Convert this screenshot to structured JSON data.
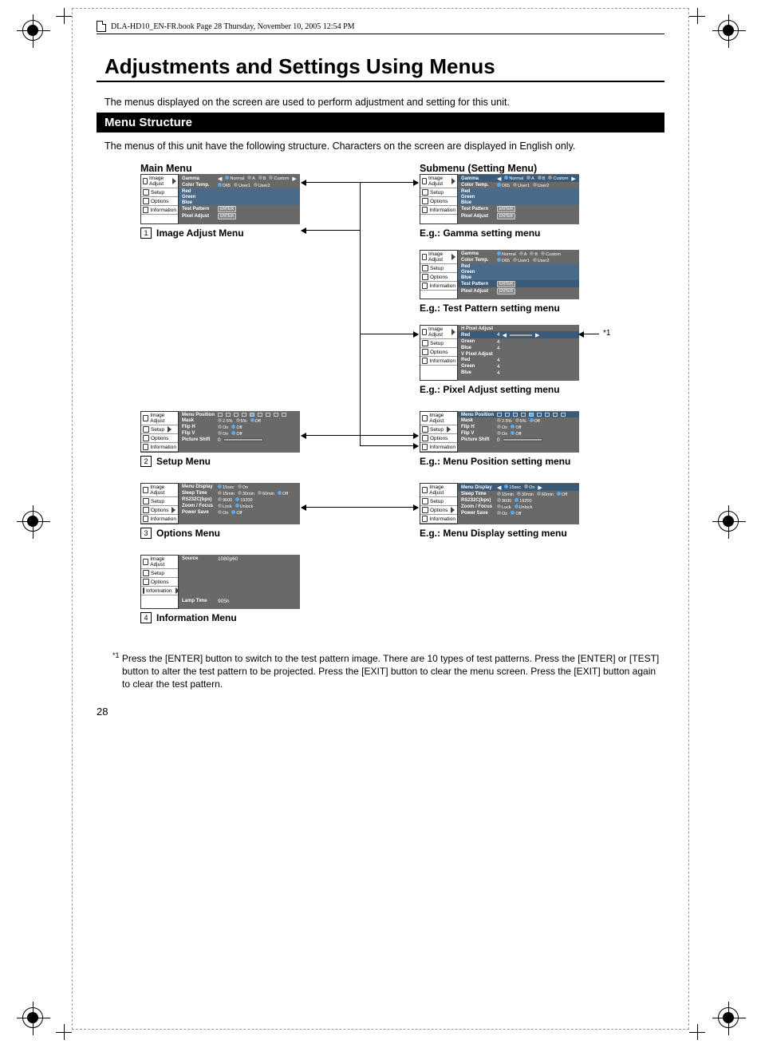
{
  "header_text": "DLA-HD10_EN-FR.book  Page 28  Thursday, November 10, 2005  12:54 PM",
  "title": "Adjustments and Settings Using Menus",
  "intro": "The menus displayed on the screen are used to perform adjustment and setting for this unit.",
  "section_heading": "Menu Structure",
  "intro2": "The menus of this unit have the following structure. Characters on the screen are displayed in English only.",
  "col_left": "Main Menu",
  "col_right": "Submenu (Setting Menu)",
  "sidebar": {
    "items": [
      "Image Adjust",
      "Setup",
      "Options",
      "Information"
    ]
  },
  "image_adjust": {
    "rows": [
      {
        "label": "Gamma",
        "opts": [
          "Normal",
          "A",
          "B",
          "Custom"
        ],
        "sel": 0,
        "arrows": true
      },
      {
        "label": "Color Temp.",
        "opts": [
          "D65",
          "User1",
          "User2"
        ],
        "sel": 0
      },
      {
        "label": "Red",
        "bar": true
      },
      {
        "label": "Green",
        "bar": true
      },
      {
        "label": "Blue",
        "bar": true
      },
      {
        "label": "Test Pattern",
        "enter": true
      },
      {
        "label": "Pixel Adjust",
        "enter": true
      }
    ]
  },
  "gamma_sub": {
    "rows": [
      {
        "label": "Gamma",
        "opts": [
          "Normal",
          "A",
          "B",
          "Custom"
        ],
        "sel": 0,
        "arrows": true,
        "hl": true
      },
      {
        "label": "Color Temp.",
        "opts": [
          "D65",
          "User1",
          "User2"
        ],
        "sel": 0
      },
      {
        "label": "Red",
        "bar": true
      },
      {
        "label": "Green",
        "bar": true
      },
      {
        "label": "Blue",
        "bar": true
      },
      {
        "label": "Test Pattern",
        "enter": true
      },
      {
        "label": "Pixel Adjust",
        "enter": true
      }
    ]
  },
  "test_pattern_sub": {
    "rows": [
      {
        "label": "Gamma",
        "opts": [
          "Normal",
          "A",
          "B",
          "Custom"
        ],
        "sel": 0
      },
      {
        "label": "Color Temp.",
        "opts": [
          "D65",
          "User1",
          "User2"
        ],
        "sel": 0
      },
      {
        "label": "Red",
        "bar": true
      },
      {
        "label": "Green",
        "bar": true
      },
      {
        "label": "Blue",
        "bar": true
      },
      {
        "label": "Test Pattern",
        "enter": true,
        "hl": true
      },
      {
        "label": "Pixel Adjust",
        "enter": true
      }
    ]
  },
  "pixel_adjust_sub": {
    "header1": "H Pixel Adjust",
    "rows1": [
      {
        "label": "Red",
        "val": "4",
        "hl": true,
        "arrows": true
      },
      {
        "label": "Green",
        "val": "4"
      },
      {
        "label": "Blue",
        "val": "4"
      }
    ],
    "header2": "V Pixel Adjust",
    "rows2": [
      {
        "label": "Red",
        "val": "4"
      },
      {
        "label": "Green",
        "val": "4"
      },
      {
        "label": "Blue",
        "val": "4"
      }
    ]
  },
  "setup": {
    "rows": [
      {
        "label": "Menu Position",
        "grid": true
      },
      {
        "label": "Mask",
        "opts": [
          "2.5%",
          "5%",
          "Off"
        ],
        "sel": 2
      },
      {
        "label": "Flip H",
        "opts": [
          "On",
          "Off"
        ],
        "sel": 1
      },
      {
        "label": "Flip V",
        "opts": [
          "On",
          "Off"
        ],
        "sel": 1
      },
      {
        "label": "Picture Shift",
        "val": "0",
        "slider": true
      }
    ]
  },
  "setup_sub": {
    "rows": [
      {
        "label": "Menu Position",
        "grid": true,
        "hl": true,
        "arrows": true
      },
      {
        "label": "Mask",
        "opts": [
          "2.5%",
          "5%",
          "Off"
        ],
        "sel": 2
      },
      {
        "label": "Flip H",
        "opts": [
          "On",
          "Off"
        ],
        "sel": 1
      },
      {
        "label": "Flip V",
        "opts": [
          "On",
          "Off"
        ],
        "sel": 1
      },
      {
        "label": "Picture Shift",
        "val": "0",
        "slider": true
      }
    ]
  },
  "options": {
    "rows": [
      {
        "label": "Menu Display",
        "opts": [
          "15sec",
          "On"
        ],
        "sel": 0
      },
      {
        "label": "Sleep Time",
        "opts": [
          "15min",
          "30min",
          "60min",
          "Off"
        ],
        "sel": 3
      },
      {
        "label": "RS232C(bps)",
        "opts": [
          "9600",
          "19200"
        ],
        "sel": 1
      },
      {
        "label": "Zoom / Focus",
        "opts": [
          "Lock",
          "Unlock"
        ],
        "sel": 1
      },
      {
        "label": "Power Save",
        "opts": [
          "On",
          "Off"
        ],
        "sel": 1
      }
    ]
  },
  "options_sub": {
    "rows": [
      {
        "label": "Menu Display",
        "opts": [
          "15sec",
          "On"
        ],
        "sel": 0,
        "hl": true,
        "arrows": true
      },
      {
        "label": "Sleep Time",
        "opts": [
          "15min",
          "30min",
          "60min",
          "Off"
        ],
        "sel": 3
      },
      {
        "label": "RS232C(bps)",
        "opts": [
          "9600",
          "19200"
        ],
        "sel": 1
      },
      {
        "label": "Zoom / Focus",
        "opts": [
          "Lock",
          "Unlock"
        ],
        "sel": 1
      },
      {
        "label": "Power Save",
        "opts": [
          "On",
          "Off"
        ],
        "sel": 1
      }
    ]
  },
  "information": {
    "rows": [
      {
        "label": "Source",
        "val": "1080p60"
      },
      {
        "spacer": true
      },
      {
        "spacer": true
      },
      {
        "spacer": true
      },
      {
        "spacer": true
      },
      {
        "spacer": true
      },
      {
        "label": "Lamp Time",
        "val": "905h"
      }
    ]
  },
  "captions": {
    "c1": "Image Adjust Menu",
    "c2": "Setup Menu",
    "c3": "Options Menu",
    "c4": "Information Menu",
    "r1": "E.g.: Gamma setting menu",
    "r2": "E.g.: Test Pattern setting menu",
    "r3": "E.g.: Pixel Adjust setting menu",
    "r4": "E.g.: Menu Position setting menu",
    "r5": "E.g.: Menu Display setting menu"
  },
  "note_ref": "*1",
  "footnote_marker": "*1",
  "footnote": "Press the [ENTER] button to switch to the test pattern image. There are 10 types of test patterns. Press the [ENTER] or [TEST] button to alter the test pattern to be projected. Press the [EXIT] button to clear the menu screen. Press the [EXIT] button again to clear the test pattern.",
  "pagenum": "28",
  "nums": {
    "n1": "1",
    "n2": "2",
    "n3": "3",
    "n4": "4"
  }
}
